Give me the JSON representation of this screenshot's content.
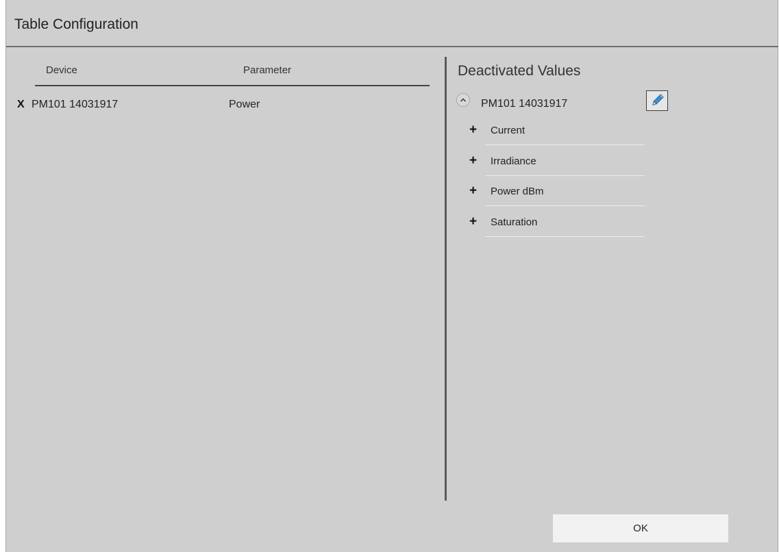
{
  "dialog": {
    "title": "Table Configuration"
  },
  "table": {
    "columns": {
      "device": "Device",
      "parameter": "Parameter"
    },
    "rows": [
      {
        "remove_label": "X",
        "device": "PM101 14031917",
        "parameter": "Power"
      }
    ]
  },
  "deactivated": {
    "title": "Deactivated Values",
    "device": "PM101 14031917",
    "collapse_icon": "chevron-up-icon",
    "edit_icon": "pencil-icon",
    "add_icon": "plus-icon",
    "items": [
      {
        "plus": "+",
        "label": "Current"
      },
      {
        "plus": "+",
        "label": "Irradiance"
      },
      {
        "plus": "+",
        "label": "Power dBm"
      },
      {
        "plus": "+",
        "label": "Saturation"
      }
    ]
  },
  "footer": {
    "ok_label": "OK"
  },
  "colors": {
    "dialog_bg": "#cfcfcf",
    "rule": "#6e6e6e",
    "ok_bg": "#f2f2f2",
    "pencil": "#3b8fd9"
  }
}
